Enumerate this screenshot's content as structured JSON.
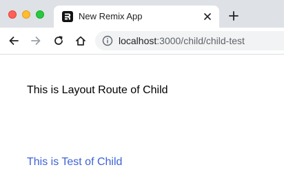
{
  "window": {
    "controls": [
      "close",
      "minimize",
      "zoom"
    ]
  },
  "tab": {
    "title": "New Remix App",
    "favicon": "remix-logo-icon",
    "close_icon": "close-icon"
  },
  "new_tab_icon": "plus-icon",
  "toolbar": {
    "back_icon": "arrow-left-icon",
    "forward_icon": "arrow-right-icon",
    "reload_icon": "reload-icon",
    "home_icon": "home-icon",
    "site_info_icon": "info-icon",
    "url_host": "localhost",
    "url_path": ":3000/child/child-test"
  },
  "page": {
    "layout_text": "This is Layout Route of Child",
    "child_text": "This is Test of Child",
    "child_text_color": "#3c62d8"
  }
}
